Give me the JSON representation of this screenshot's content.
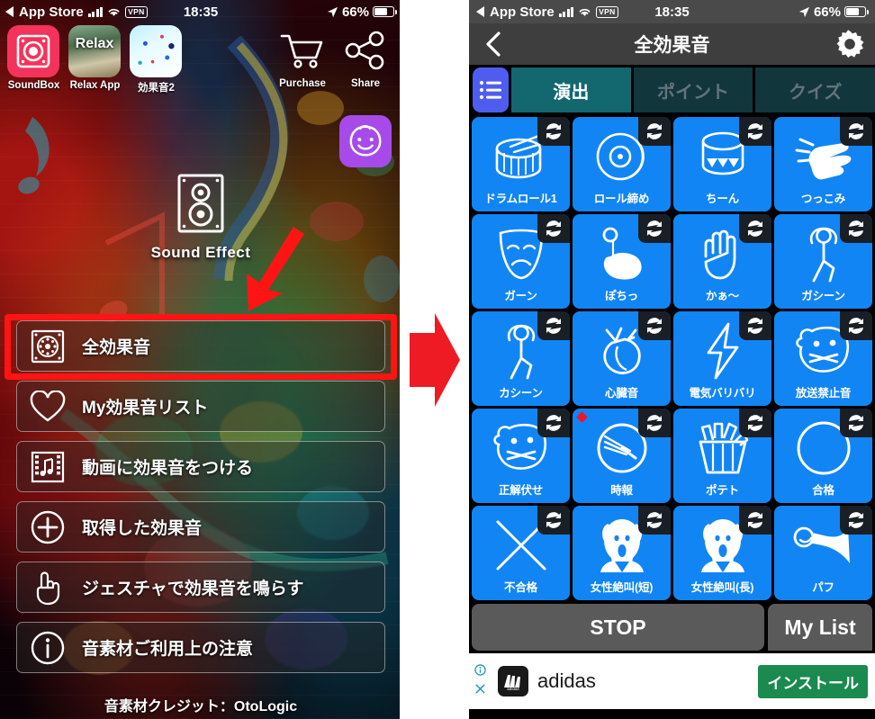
{
  "left_phone": {
    "status_bar": {
      "back_app": "App Store",
      "signal_icon": "cellular-signal-icon",
      "wifi_icon": "wifi-icon",
      "vpn_label": "VPN",
      "time": "18:35",
      "location_icon": "location-arrow-icon",
      "battery_percent": "66%",
      "battery_icon": "battery-icon"
    },
    "home_icons": [
      {
        "label": "SoundBox",
        "icon": "soundbox-app-icon"
      },
      {
        "label": "Relax App",
        "icon": "relax-app-icon",
        "tile_text": "Relax"
      },
      {
        "label": "効果音2",
        "icon": "koukaon2-app-icon"
      },
      {
        "label": "Purchase",
        "icon": "shopping-cart-icon"
      },
      {
        "label": "Share",
        "icon": "share-node-icon"
      }
    ],
    "brand": {
      "icon": "speaker-box-icon",
      "title": "Sound Effect"
    },
    "menu": [
      {
        "label": "全効果音",
        "icon": "speaker-grill-icon",
        "highlighted": true
      },
      {
        "label": "My効果音リスト",
        "icon": "heart-icon",
        "highlighted": false
      },
      {
        "label": "動画に効果音をつける",
        "icon": "film-music-icon",
        "highlighted": false
      },
      {
        "label": "取得した効果音",
        "icon": "plus-circle-icon",
        "highlighted": false
      },
      {
        "label": "ジェスチャで効果音を鳴らす",
        "icon": "pointing-hand-icon",
        "highlighted": false
      },
      {
        "label": "音素材ご利用上の注意",
        "icon": "info-circle-icon",
        "highlighted": false
      }
    ],
    "credit": "音素材クレジット：OtoLogic",
    "annotations": {
      "down_arrow": "red-down-arrow",
      "highlight_box_color": "#ff1414"
    }
  },
  "transition_arrow": {
    "icon": "red-right-arrow",
    "color": "#ee1b24"
  },
  "right_phone": {
    "status_bar": {
      "back_app": "App Store",
      "signal_icon": "cellular-signal-icon",
      "wifi_icon": "wifi-icon",
      "vpn_label": "VPN",
      "time": "18:35",
      "location_icon": "location-arrow-icon",
      "battery_percent": "66%",
      "battery_icon": "battery-icon"
    },
    "nav": {
      "back_icon": "chevron-left-icon",
      "title": "全効果音",
      "settings_icon": "gear-icon"
    },
    "tabs": {
      "list_button_icon": "list-icon",
      "items": [
        {
          "label": "演出",
          "active": true
        },
        {
          "label": "ポイント",
          "active": false
        },
        {
          "label": "クイズ",
          "active": false
        }
      ]
    },
    "sound_grid": {
      "tile_color": "#1285f5",
      "loop_icon": "loop-repeat-icon",
      "items": [
        {
          "label": "ドラムロール1",
          "icon": "snare-drum-icon",
          "loop": true,
          "badge": false
        },
        {
          "label": "ロール締め",
          "icon": "cymbal-icon",
          "loop": true,
          "badge": false
        },
        {
          "label": "ちーん",
          "icon": "bell-bowl-icon",
          "loop": true,
          "badge": false
        },
        {
          "label": "つっこみ",
          "icon": "slap-hand-icon",
          "loop": true,
          "badge": false
        },
        {
          "label": "ガーン",
          "icon": "sad-mask-icon",
          "loop": true,
          "badge": false
        },
        {
          "label": "ぽちっ",
          "icon": "tap-finger-icon",
          "loop": true,
          "badge": false
        },
        {
          "label": "かぁ〜",
          "icon": "open-palm-icon",
          "loop": true,
          "badge": false
        },
        {
          "label": "ガシーン",
          "icon": "pose-person-icon",
          "loop": true,
          "badge": false
        },
        {
          "label": "カシーン",
          "icon": "pose-person-icon",
          "loop": true,
          "badge": false
        },
        {
          "label": "心臓音",
          "icon": "heart-organ-icon",
          "loop": true,
          "badge": false
        },
        {
          "label": "電気バリバリ",
          "icon": "lightning-bolt-icon",
          "loop": true,
          "badge": false
        },
        {
          "label": "放送禁止音",
          "icon": "taped-mouth-face-icon",
          "loop": true,
          "badge": false
        },
        {
          "label": "正解伏せ",
          "icon": "taped-mouth-face-icon",
          "loop": true,
          "badge": false
        },
        {
          "label": "時報",
          "icon": "clock-icon",
          "loop": true,
          "badge": true
        },
        {
          "label": "ポテト",
          "icon": "fries-icon",
          "loop": true,
          "badge": false
        },
        {
          "label": "合格",
          "icon": "circle-icon",
          "loop": true,
          "badge": false
        },
        {
          "label": "不合格",
          "icon": "cross-x-icon",
          "loop": true,
          "badge": false
        },
        {
          "label": "女性絶叫(短)",
          "icon": "scream-face-icon",
          "loop": true,
          "badge": false
        },
        {
          "label": "女性絶叫(長)",
          "icon": "scream-face-icon",
          "loop": true,
          "badge": false
        },
        {
          "label": "パフ",
          "icon": "air-horn-icon",
          "loop": true,
          "badge": false
        }
      ]
    },
    "bottom_bar": {
      "stop_label": "STOP",
      "mylist_label": "My List"
    },
    "ad_banner": {
      "info_icon": "ad-info-icon",
      "close_icon": "ad-close-icon",
      "advertiser": "adidas",
      "logo_icon": "adidas-logo-icon",
      "cta_label": "インストール",
      "cta_color": "#1a8a4f"
    }
  }
}
